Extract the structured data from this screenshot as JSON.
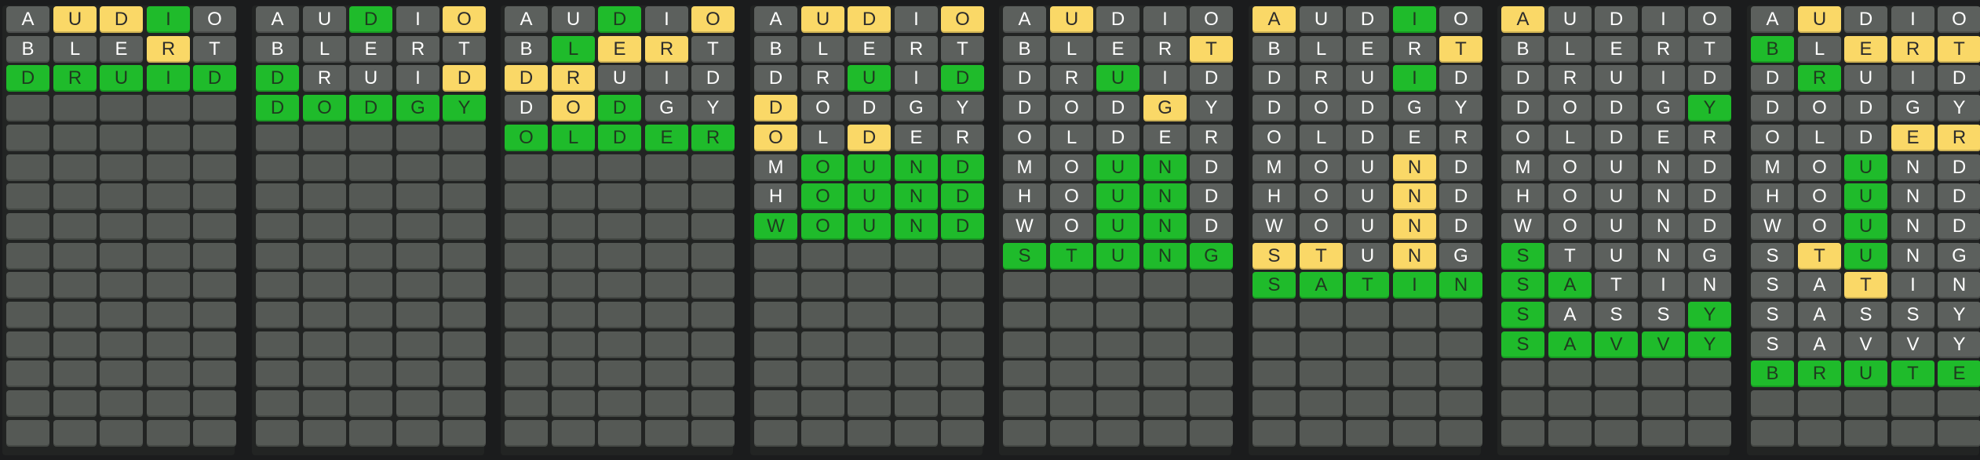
{
  "game": "Octordle-style word grid",
  "colors": {
    "background": "#1b1c1d",
    "empty": "#555955",
    "absent": "#5c605d",
    "present": "#fad867",
    "correct": "#1fbb2b"
  },
  "rows_per_board": 15,
  "boards": [
    {
      "rows": [
        {
          "letters": [
            "A",
            "U",
            "D",
            "I",
            "O"
          ],
          "states": [
            "a",
            "p",
            "p",
            "c",
            "a"
          ]
        },
        {
          "letters": [
            "B",
            "L",
            "E",
            "R",
            "T"
          ],
          "states": [
            "a",
            "a",
            "a",
            "p",
            "a"
          ]
        },
        {
          "letters": [
            "D",
            "R",
            "U",
            "I",
            "D"
          ],
          "states": [
            "c",
            "c",
            "c",
            "c",
            "c"
          ]
        }
      ]
    },
    {
      "rows": [
        {
          "letters": [
            "A",
            "U",
            "D",
            "I",
            "O"
          ],
          "states": [
            "a",
            "a",
            "c",
            "a",
            "p"
          ]
        },
        {
          "letters": [
            "B",
            "L",
            "E",
            "R",
            "T"
          ],
          "states": [
            "a",
            "a",
            "a",
            "a",
            "a"
          ]
        },
        {
          "letters": [
            "D",
            "R",
            "U",
            "I",
            "D"
          ],
          "states": [
            "c",
            "a",
            "a",
            "a",
            "p"
          ]
        },
        {
          "letters": [
            "D",
            "O",
            "D",
            "G",
            "Y"
          ],
          "states": [
            "c",
            "c",
            "c",
            "c",
            "c"
          ]
        }
      ]
    },
    {
      "rows": [
        {
          "letters": [
            "A",
            "U",
            "D",
            "I",
            "O"
          ],
          "states": [
            "a",
            "a",
            "c",
            "a",
            "p"
          ]
        },
        {
          "letters": [
            "B",
            "L",
            "E",
            "R",
            "T"
          ],
          "states": [
            "a",
            "c",
            "p",
            "p",
            "a"
          ]
        },
        {
          "letters": [
            "D",
            "R",
            "U",
            "I",
            "D"
          ],
          "states": [
            "p",
            "p",
            "a",
            "a",
            "a"
          ]
        },
        {
          "letters": [
            "D",
            "O",
            "D",
            "G",
            "Y"
          ],
          "states": [
            "a",
            "p",
            "c",
            "a",
            "a"
          ]
        },
        {
          "letters": [
            "O",
            "L",
            "D",
            "E",
            "R"
          ],
          "states": [
            "c",
            "c",
            "c",
            "c",
            "c"
          ]
        }
      ]
    },
    {
      "rows": [
        {
          "letters": [
            "A",
            "U",
            "D",
            "I",
            "O"
          ],
          "states": [
            "a",
            "p",
            "p",
            "a",
            "p"
          ]
        },
        {
          "letters": [
            "B",
            "L",
            "E",
            "R",
            "T"
          ],
          "states": [
            "a",
            "a",
            "a",
            "a",
            "a"
          ]
        },
        {
          "letters": [
            "D",
            "R",
            "U",
            "I",
            "D"
          ],
          "states": [
            "a",
            "a",
            "c",
            "a",
            "c"
          ]
        },
        {
          "letters": [
            "D",
            "O",
            "D",
            "G",
            "Y"
          ],
          "states": [
            "p",
            "a",
            "a",
            "a",
            "a"
          ]
        },
        {
          "letters": [
            "O",
            "L",
            "D",
            "E",
            "R"
          ],
          "states": [
            "p",
            "a",
            "p",
            "a",
            "a"
          ]
        },
        {
          "letters": [
            "M",
            "O",
            "U",
            "N",
            "D"
          ],
          "states": [
            "a",
            "c",
            "c",
            "c",
            "c"
          ]
        },
        {
          "letters": [
            "H",
            "O",
            "U",
            "N",
            "D"
          ],
          "states": [
            "a",
            "c",
            "c",
            "c",
            "c"
          ]
        },
        {
          "letters": [
            "W",
            "O",
            "U",
            "N",
            "D"
          ],
          "states": [
            "c",
            "c",
            "c",
            "c",
            "c"
          ]
        }
      ]
    },
    {
      "rows": [
        {
          "letters": [
            "A",
            "U",
            "D",
            "I",
            "O"
          ],
          "states": [
            "a",
            "p",
            "a",
            "a",
            "a"
          ]
        },
        {
          "letters": [
            "B",
            "L",
            "E",
            "R",
            "T"
          ],
          "states": [
            "a",
            "a",
            "a",
            "a",
            "p"
          ]
        },
        {
          "letters": [
            "D",
            "R",
            "U",
            "I",
            "D"
          ],
          "states": [
            "a",
            "a",
            "c",
            "a",
            "a"
          ]
        },
        {
          "letters": [
            "D",
            "O",
            "D",
            "G",
            "Y"
          ],
          "states": [
            "a",
            "a",
            "a",
            "p",
            "a"
          ]
        },
        {
          "letters": [
            "O",
            "L",
            "D",
            "E",
            "R"
          ],
          "states": [
            "a",
            "a",
            "a",
            "a",
            "a"
          ]
        },
        {
          "letters": [
            "M",
            "O",
            "U",
            "N",
            "D"
          ],
          "states": [
            "a",
            "a",
            "c",
            "c",
            "a"
          ]
        },
        {
          "letters": [
            "H",
            "O",
            "U",
            "N",
            "D"
          ],
          "states": [
            "a",
            "a",
            "c",
            "c",
            "a"
          ]
        },
        {
          "letters": [
            "W",
            "O",
            "U",
            "N",
            "D"
          ],
          "states": [
            "a",
            "a",
            "c",
            "c",
            "a"
          ]
        },
        {
          "letters": [
            "S",
            "T",
            "U",
            "N",
            "G"
          ],
          "states": [
            "c",
            "c",
            "c",
            "c",
            "c"
          ]
        }
      ]
    },
    {
      "rows": [
        {
          "letters": [
            "A",
            "U",
            "D",
            "I",
            "O"
          ],
          "states": [
            "p",
            "a",
            "a",
            "c",
            "a"
          ]
        },
        {
          "letters": [
            "B",
            "L",
            "E",
            "R",
            "T"
          ],
          "states": [
            "a",
            "a",
            "a",
            "a",
            "p"
          ]
        },
        {
          "letters": [
            "D",
            "R",
            "U",
            "I",
            "D"
          ],
          "states": [
            "a",
            "a",
            "a",
            "c",
            "a"
          ]
        },
        {
          "letters": [
            "D",
            "O",
            "D",
            "G",
            "Y"
          ],
          "states": [
            "a",
            "a",
            "a",
            "a",
            "a"
          ]
        },
        {
          "letters": [
            "O",
            "L",
            "D",
            "E",
            "R"
          ],
          "states": [
            "a",
            "a",
            "a",
            "a",
            "a"
          ]
        },
        {
          "letters": [
            "M",
            "O",
            "U",
            "N",
            "D"
          ],
          "states": [
            "a",
            "a",
            "a",
            "p",
            "a"
          ]
        },
        {
          "letters": [
            "H",
            "O",
            "U",
            "N",
            "D"
          ],
          "states": [
            "a",
            "a",
            "a",
            "p",
            "a"
          ]
        },
        {
          "letters": [
            "W",
            "O",
            "U",
            "N",
            "D"
          ],
          "states": [
            "a",
            "a",
            "a",
            "p",
            "a"
          ]
        },
        {
          "letters": [
            "S",
            "T",
            "U",
            "N",
            "G"
          ],
          "states": [
            "p",
            "p",
            "a",
            "p",
            "a"
          ]
        },
        {
          "letters": [
            "S",
            "A",
            "T",
            "I",
            "N"
          ],
          "states": [
            "c",
            "c",
            "c",
            "c",
            "c"
          ]
        }
      ]
    },
    {
      "rows": [
        {
          "letters": [
            "A",
            "U",
            "D",
            "I",
            "O"
          ],
          "states": [
            "p",
            "a",
            "a",
            "a",
            "a"
          ]
        },
        {
          "letters": [
            "B",
            "L",
            "E",
            "R",
            "T"
          ],
          "states": [
            "a",
            "a",
            "a",
            "a",
            "a"
          ]
        },
        {
          "letters": [
            "D",
            "R",
            "U",
            "I",
            "D"
          ],
          "states": [
            "a",
            "a",
            "a",
            "a",
            "a"
          ]
        },
        {
          "letters": [
            "D",
            "O",
            "D",
            "G",
            "Y"
          ],
          "states": [
            "a",
            "a",
            "a",
            "a",
            "c"
          ]
        },
        {
          "letters": [
            "O",
            "L",
            "D",
            "E",
            "R"
          ],
          "states": [
            "a",
            "a",
            "a",
            "a",
            "a"
          ]
        },
        {
          "letters": [
            "M",
            "O",
            "U",
            "N",
            "D"
          ],
          "states": [
            "a",
            "a",
            "a",
            "a",
            "a"
          ]
        },
        {
          "letters": [
            "H",
            "O",
            "U",
            "N",
            "D"
          ],
          "states": [
            "a",
            "a",
            "a",
            "a",
            "a"
          ]
        },
        {
          "letters": [
            "W",
            "O",
            "U",
            "N",
            "D"
          ],
          "states": [
            "a",
            "a",
            "a",
            "a",
            "a"
          ]
        },
        {
          "letters": [
            "S",
            "T",
            "U",
            "N",
            "G"
          ],
          "states": [
            "c",
            "a",
            "a",
            "a",
            "a"
          ]
        },
        {
          "letters": [
            "S",
            "A",
            "T",
            "I",
            "N"
          ],
          "states": [
            "c",
            "c",
            "a",
            "a",
            "a"
          ]
        },
        {
          "letters": [
            "S",
            "A",
            "S",
            "S",
            "Y"
          ],
          "states": [
            "c",
            "a",
            "a",
            "a",
            "c"
          ]
        },
        {
          "letters": [
            "S",
            "A",
            "V",
            "V",
            "Y"
          ],
          "states": [
            "c",
            "c",
            "c",
            "c",
            "c"
          ]
        }
      ]
    },
    {
      "rows": [
        {
          "letters": [
            "A",
            "U",
            "D",
            "I",
            "O"
          ],
          "states": [
            "a",
            "p",
            "a",
            "a",
            "a"
          ]
        },
        {
          "letters": [
            "B",
            "L",
            "E",
            "R",
            "T"
          ],
          "states": [
            "c",
            "a",
            "p",
            "p",
            "p"
          ]
        },
        {
          "letters": [
            "D",
            "R",
            "U",
            "I",
            "D"
          ],
          "states": [
            "a",
            "c",
            "a",
            "a",
            "a"
          ]
        },
        {
          "letters": [
            "D",
            "O",
            "D",
            "G",
            "Y"
          ],
          "states": [
            "a",
            "a",
            "a",
            "a",
            "a"
          ]
        },
        {
          "letters": [
            "O",
            "L",
            "D",
            "E",
            "R"
          ],
          "states": [
            "a",
            "a",
            "a",
            "p",
            "p"
          ]
        },
        {
          "letters": [
            "M",
            "O",
            "U",
            "N",
            "D"
          ],
          "states": [
            "a",
            "a",
            "c",
            "a",
            "a"
          ]
        },
        {
          "letters": [
            "H",
            "O",
            "U",
            "N",
            "D"
          ],
          "states": [
            "a",
            "a",
            "c",
            "a",
            "a"
          ]
        },
        {
          "letters": [
            "W",
            "O",
            "U",
            "N",
            "D"
          ],
          "states": [
            "a",
            "a",
            "c",
            "a",
            "a"
          ]
        },
        {
          "letters": [
            "S",
            "T",
            "U",
            "N",
            "G"
          ],
          "states": [
            "a",
            "p",
            "c",
            "a",
            "a"
          ]
        },
        {
          "letters": [
            "S",
            "A",
            "T",
            "I",
            "N"
          ],
          "states": [
            "a",
            "a",
            "p",
            "a",
            "a"
          ]
        },
        {
          "letters": [
            "S",
            "A",
            "S",
            "S",
            "Y"
          ],
          "states": [
            "a",
            "a",
            "a",
            "a",
            "a"
          ]
        },
        {
          "letters": [
            "S",
            "A",
            "V",
            "V",
            "Y"
          ],
          "states": [
            "a",
            "a",
            "a",
            "a",
            "a"
          ]
        },
        {
          "letters": [
            "B",
            "R",
            "U",
            "T",
            "E"
          ],
          "states": [
            "c",
            "c",
            "c",
            "c",
            "c"
          ]
        }
      ]
    }
  ]
}
